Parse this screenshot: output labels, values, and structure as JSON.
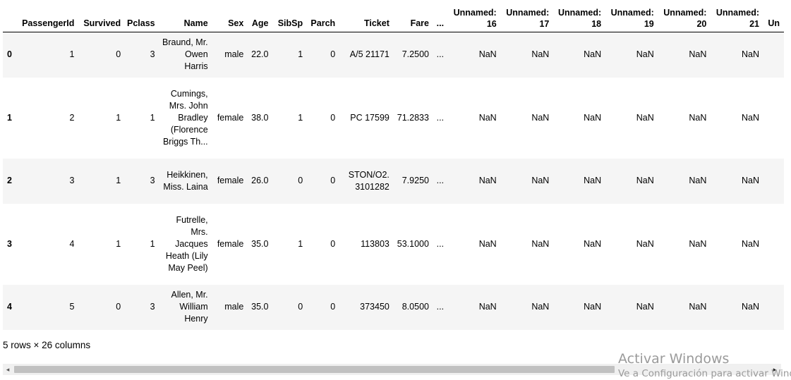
{
  "table": {
    "columns": [
      "",
      "PassengerId",
      "Survived",
      "Pclass",
      "Name",
      "Sex",
      "Age",
      "SibSp",
      "Parch",
      "Ticket",
      "Fare",
      "...",
      "Unnamed: 16",
      "Unnamed: 17",
      "Unnamed: 18",
      "Unnamed: 19",
      "Unnamed: 20",
      "Unnamed: 21",
      "Un"
    ],
    "rows": [
      [
        "0",
        "1",
        "0",
        "3",
        "Braund, Mr. Owen Harris",
        "male",
        "22.0",
        "1",
        "0",
        "A/5 21171",
        "7.2500",
        "...",
        "NaN",
        "NaN",
        "NaN",
        "NaN",
        "NaN",
        "NaN"
      ],
      [
        "1",
        "2",
        "1",
        "1",
        "Cumings, Mrs. John Bradley (Florence Briggs Th...",
        "female",
        "38.0",
        "1",
        "0",
        "PC 17599",
        "71.2833",
        "...",
        "NaN",
        "NaN",
        "NaN",
        "NaN",
        "NaN",
        "NaN"
      ],
      [
        "2",
        "3",
        "1",
        "3",
        "Heikkinen, Miss. Laina",
        "female",
        "26.0",
        "0",
        "0",
        "STON/O2. 3101282",
        "7.9250",
        "...",
        "NaN",
        "NaN",
        "NaN",
        "NaN",
        "NaN",
        "NaN"
      ],
      [
        "3",
        "4",
        "1",
        "1",
        "Futrelle, Mrs. Jacques Heath (Lily May Peel)",
        "female",
        "35.0",
        "1",
        "0",
        "113803",
        "53.1000",
        "...",
        "NaN",
        "NaN",
        "NaN",
        "NaN",
        "NaN",
        "NaN"
      ],
      [
        "4",
        "5",
        "0",
        "3",
        "Allen, Mr. William Henry",
        "male",
        "35.0",
        "0",
        "0",
        "373450",
        "8.0500",
        "...",
        "NaN",
        "NaN",
        "NaN",
        "NaN",
        "NaN",
        "NaN"
      ]
    ]
  },
  "summary": "5 rows × 26 columns",
  "scrollbar": {
    "left_arrow": "◂",
    "right_arrow": "▸"
  },
  "watermark": {
    "title": "Activar Windows",
    "subtitle": "Ve a Configuración para activar Windows."
  }
}
